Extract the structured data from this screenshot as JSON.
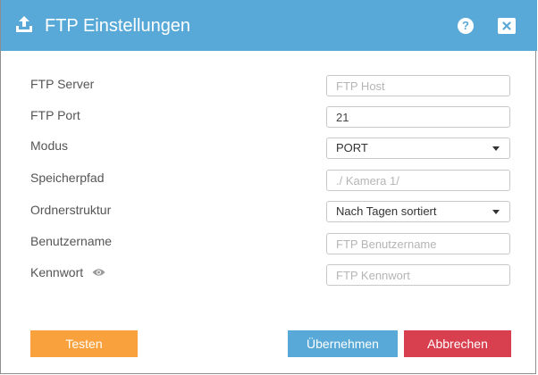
{
  "dialog": {
    "title": "FTP Einstellungen",
    "help_icon": "question-circle-icon",
    "close_icon": "close-box-icon",
    "title_icon": "upload-icon"
  },
  "form": {
    "server": {
      "label": "FTP Server",
      "value": "",
      "placeholder": "FTP Host"
    },
    "port": {
      "label": "FTP Port",
      "value": "21",
      "placeholder": ""
    },
    "mode": {
      "label": "Modus",
      "selected": "PORT"
    },
    "path": {
      "label": "Speicherpfad",
      "value": "",
      "placeholder": "./ Kamera 1/"
    },
    "structure": {
      "label": "Ordnerstruktur",
      "selected": "Nach Tagen sortiert"
    },
    "username": {
      "label": "Benutzername",
      "value": "",
      "placeholder": "FTP Benutzername"
    },
    "password": {
      "label": "Kennwort",
      "value": "",
      "placeholder": "FTP Kennwort",
      "icon": "eye-icon"
    }
  },
  "buttons": {
    "test": "Testen",
    "apply": "Übernehmen",
    "cancel": "Abbrechen"
  },
  "colors": {
    "header": "#58a9d7",
    "test": "#f9a23d",
    "apply": "#58a9d7",
    "cancel": "#d9404f"
  }
}
